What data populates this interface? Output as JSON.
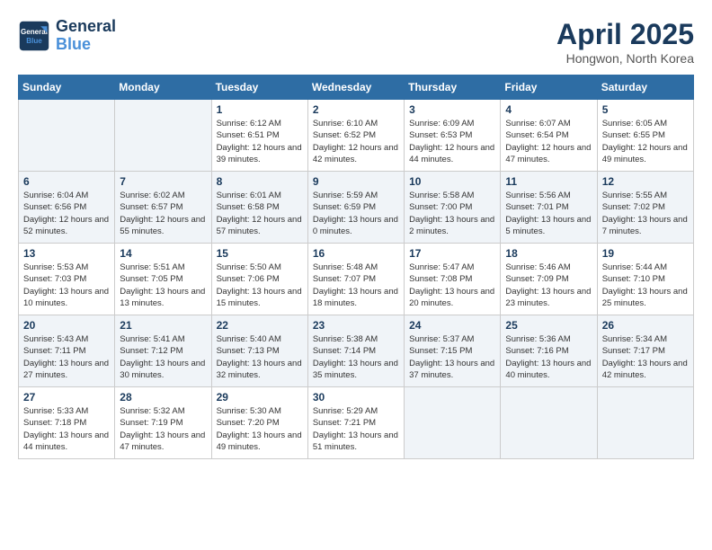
{
  "logo": {
    "line1": "General",
    "line2": "Blue"
  },
  "title": "April 2025",
  "subtitle": "Hongwon, North Korea",
  "days_of_week": [
    "Sunday",
    "Monday",
    "Tuesday",
    "Wednesday",
    "Thursday",
    "Friday",
    "Saturday"
  ],
  "weeks": [
    [
      {
        "day": "",
        "info": ""
      },
      {
        "day": "",
        "info": ""
      },
      {
        "day": "1",
        "info": "Sunrise: 6:12 AM\nSunset: 6:51 PM\nDaylight: 12 hours and 39 minutes."
      },
      {
        "day": "2",
        "info": "Sunrise: 6:10 AM\nSunset: 6:52 PM\nDaylight: 12 hours and 42 minutes."
      },
      {
        "day": "3",
        "info": "Sunrise: 6:09 AM\nSunset: 6:53 PM\nDaylight: 12 hours and 44 minutes."
      },
      {
        "day": "4",
        "info": "Sunrise: 6:07 AM\nSunset: 6:54 PM\nDaylight: 12 hours and 47 minutes."
      },
      {
        "day": "5",
        "info": "Sunrise: 6:05 AM\nSunset: 6:55 PM\nDaylight: 12 hours and 49 minutes."
      }
    ],
    [
      {
        "day": "6",
        "info": "Sunrise: 6:04 AM\nSunset: 6:56 PM\nDaylight: 12 hours and 52 minutes."
      },
      {
        "day": "7",
        "info": "Sunrise: 6:02 AM\nSunset: 6:57 PM\nDaylight: 12 hours and 55 minutes."
      },
      {
        "day": "8",
        "info": "Sunrise: 6:01 AM\nSunset: 6:58 PM\nDaylight: 12 hours and 57 minutes."
      },
      {
        "day": "9",
        "info": "Sunrise: 5:59 AM\nSunset: 6:59 PM\nDaylight: 13 hours and 0 minutes."
      },
      {
        "day": "10",
        "info": "Sunrise: 5:58 AM\nSunset: 7:00 PM\nDaylight: 13 hours and 2 minutes."
      },
      {
        "day": "11",
        "info": "Sunrise: 5:56 AM\nSunset: 7:01 PM\nDaylight: 13 hours and 5 minutes."
      },
      {
        "day": "12",
        "info": "Sunrise: 5:55 AM\nSunset: 7:02 PM\nDaylight: 13 hours and 7 minutes."
      }
    ],
    [
      {
        "day": "13",
        "info": "Sunrise: 5:53 AM\nSunset: 7:03 PM\nDaylight: 13 hours and 10 minutes."
      },
      {
        "day": "14",
        "info": "Sunrise: 5:51 AM\nSunset: 7:05 PM\nDaylight: 13 hours and 13 minutes."
      },
      {
        "day": "15",
        "info": "Sunrise: 5:50 AM\nSunset: 7:06 PM\nDaylight: 13 hours and 15 minutes."
      },
      {
        "day": "16",
        "info": "Sunrise: 5:48 AM\nSunset: 7:07 PM\nDaylight: 13 hours and 18 minutes."
      },
      {
        "day": "17",
        "info": "Sunrise: 5:47 AM\nSunset: 7:08 PM\nDaylight: 13 hours and 20 minutes."
      },
      {
        "day": "18",
        "info": "Sunrise: 5:46 AM\nSunset: 7:09 PM\nDaylight: 13 hours and 23 minutes."
      },
      {
        "day": "19",
        "info": "Sunrise: 5:44 AM\nSunset: 7:10 PM\nDaylight: 13 hours and 25 minutes."
      }
    ],
    [
      {
        "day": "20",
        "info": "Sunrise: 5:43 AM\nSunset: 7:11 PM\nDaylight: 13 hours and 27 minutes."
      },
      {
        "day": "21",
        "info": "Sunrise: 5:41 AM\nSunset: 7:12 PM\nDaylight: 13 hours and 30 minutes."
      },
      {
        "day": "22",
        "info": "Sunrise: 5:40 AM\nSunset: 7:13 PM\nDaylight: 13 hours and 32 minutes."
      },
      {
        "day": "23",
        "info": "Sunrise: 5:38 AM\nSunset: 7:14 PM\nDaylight: 13 hours and 35 minutes."
      },
      {
        "day": "24",
        "info": "Sunrise: 5:37 AM\nSunset: 7:15 PM\nDaylight: 13 hours and 37 minutes."
      },
      {
        "day": "25",
        "info": "Sunrise: 5:36 AM\nSunset: 7:16 PM\nDaylight: 13 hours and 40 minutes."
      },
      {
        "day": "26",
        "info": "Sunrise: 5:34 AM\nSunset: 7:17 PM\nDaylight: 13 hours and 42 minutes."
      }
    ],
    [
      {
        "day": "27",
        "info": "Sunrise: 5:33 AM\nSunset: 7:18 PM\nDaylight: 13 hours and 44 minutes."
      },
      {
        "day": "28",
        "info": "Sunrise: 5:32 AM\nSunset: 7:19 PM\nDaylight: 13 hours and 47 minutes."
      },
      {
        "day": "29",
        "info": "Sunrise: 5:30 AM\nSunset: 7:20 PM\nDaylight: 13 hours and 49 minutes."
      },
      {
        "day": "30",
        "info": "Sunrise: 5:29 AM\nSunset: 7:21 PM\nDaylight: 13 hours and 51 minutes."
      },
      {
        "day": "",
        "info": ""
      },
      {
        "day": "",
        "info": ""
      },
      {
        "day": "",
        "info": ""
      }
    ]
  ]
}
